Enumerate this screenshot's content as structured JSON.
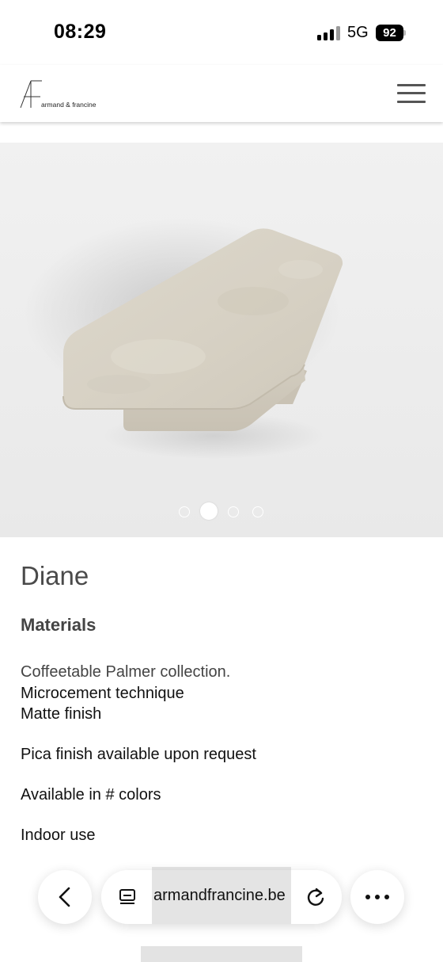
{
  "status_bar": {
    "time": "08:29",
    "network": "5G",
    "battery": "92"
  },
  "header": {
    "logo_text": "armand & francine",
    "menu_icon": "hamburger-menu-icon"
  },
  "gallery": {
    "image": "coffee-table-product-photo",
    "slide_count": 4,
    "active_slide": 2
  },
  "product": {
    "title": "Diane",
    "materials_heading": "Materials",
    "description_lines": [
      "Coffeetable Palmer collection.",
      "Microcement technique",
      "Matte finish",
      "Pica finish available upon request",
      "Available in # colors",
      "Indoor use"
    ]
  },
  "browser": {
    "address": "armandfrancine.be",
    "back_icon": "chevron-left-icon",
    "reader_icon": "reader-mode-icon",
    "reload_icon": "reload-icon",
    "more_icon": "more-dots-icon"
  }
}
